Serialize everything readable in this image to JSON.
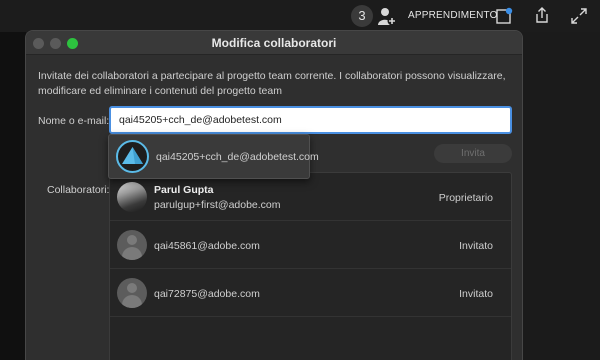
{
  "topbar": {
    "notification_count": "3",
    "learn_label": "APPRENDIMENTO"
  },
  "dialog": {
    "title": "Modifica collaboratori",
    "description": "Invitate dei collaboratori a partecipare al progetto team corrente. I collaboratori possono visualizzare, modificare ed eliminare i contenuti del progetto team",
    "name_label": "Nome o e-mail:",
    "email_value": "qai45205+cch_de@adobetest.com",
    "invite_label": "Invita",
    "collaborators_label": "Collaboratori:",
    "autocomplete": {
      "suggestion": "qai45205+cch_de@adobetest.com"
    },
    "collaborators": [
      {
        "name": "Parul Gupta",
        "email": "parulgup+first@adobe.com",
        "role": "Proprietario"
      },
      {
        "name": "",
        "email": "qai45861@adobe.com",
        "role": "Invitato"
      },
      {
        "name": "",
        "email": "qai72875@adobe.com",
        "role": "Invitato"
      }
    ]
  },
  "colors": {
    "accent": "#4a90e2",
    "zoom_button": "#2dc23f",
    "dialog_bg": "#2f2f2f",
    "suggest_avatar_ring": "#5bbbe8"
  }
}
